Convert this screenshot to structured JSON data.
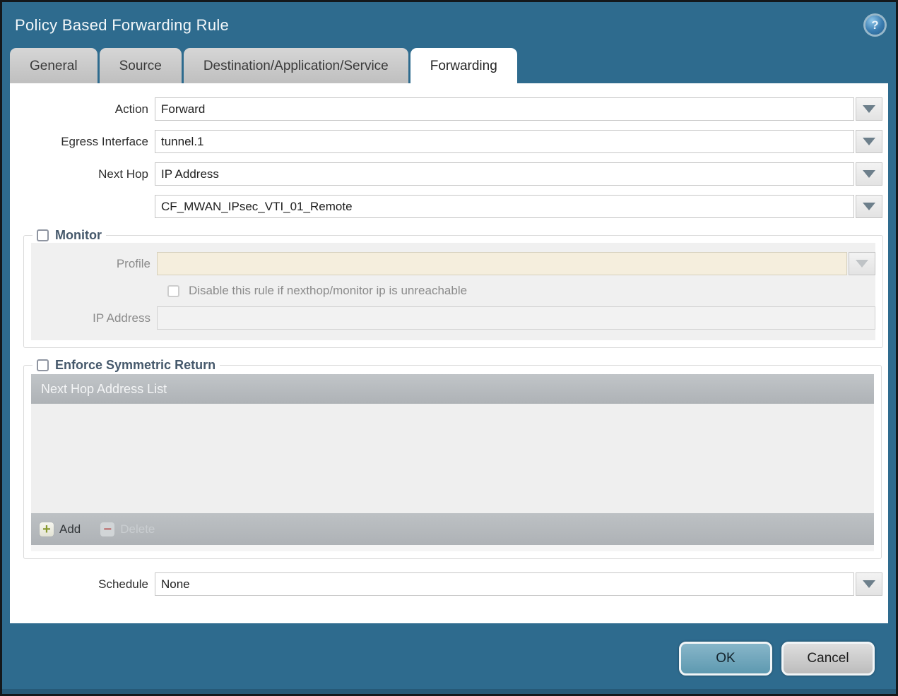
{
  "dialog": {
    "title": "Policy Based Forwarding Rule",
    "help_icon": "?"
  },
  "tabs": [
    {
      "label": "General"
    },
    {
      "label": "Source"
    },
    {
      "label": "Destination/Application/Service"
    },
    {
      "label": "Forwarding"
    }
  ],
  "form": {
    "action": {
      "label": "Action",
      "value": "Forward"
    },
    "egress_interface": {
      "label": "Egress Interface",
      "value": "tunnel.1"
    },
    "next_hop": {
      "label": "Next Hop",
      "value": "IP Address"
    },
    "next_hop_address": {
      "value": "CF_MWAN_IPsec_VTI_01_Remote"
    },
    "schedule": {
      "label": "Schedule",
      "value": "None"
    }
  },
  "monitor": {
    "legend": "Monitor",
    "checked": false,
    "profile": {
      "label": "Profile",
      "value": ""
    },
    "disable_rule": {
      "label": "Disable this rule if nexthop/monitor ip is unreachable",
      "checked": false
    },
    "ip_address": {
      "label": "IP Address",
      "value": ""
    }
  },
  "symmetric_return": {
    "legend": "Enforce Symmetric Return",
    "checked": false,
    "table_header": "Next Hop Address List",
    "rows": [],
    "add_label": "Add",
    "add_icon": "+",
    "delete_label": "Delete",
    "delete_icon": "−"
  },
  "footer": {
    "ok_label": "OK",
    "cancel_label": "Cancel"
  },
  "colors": {
    "frame_teal": "#2e6b8e",
    "ok_button": "#6da6bc",
    "disabled_field_beige": "#f5eedd",
    "table_bar_gray": "#b2b6b9",
    "legend_text": "#45586b"
  }
}
